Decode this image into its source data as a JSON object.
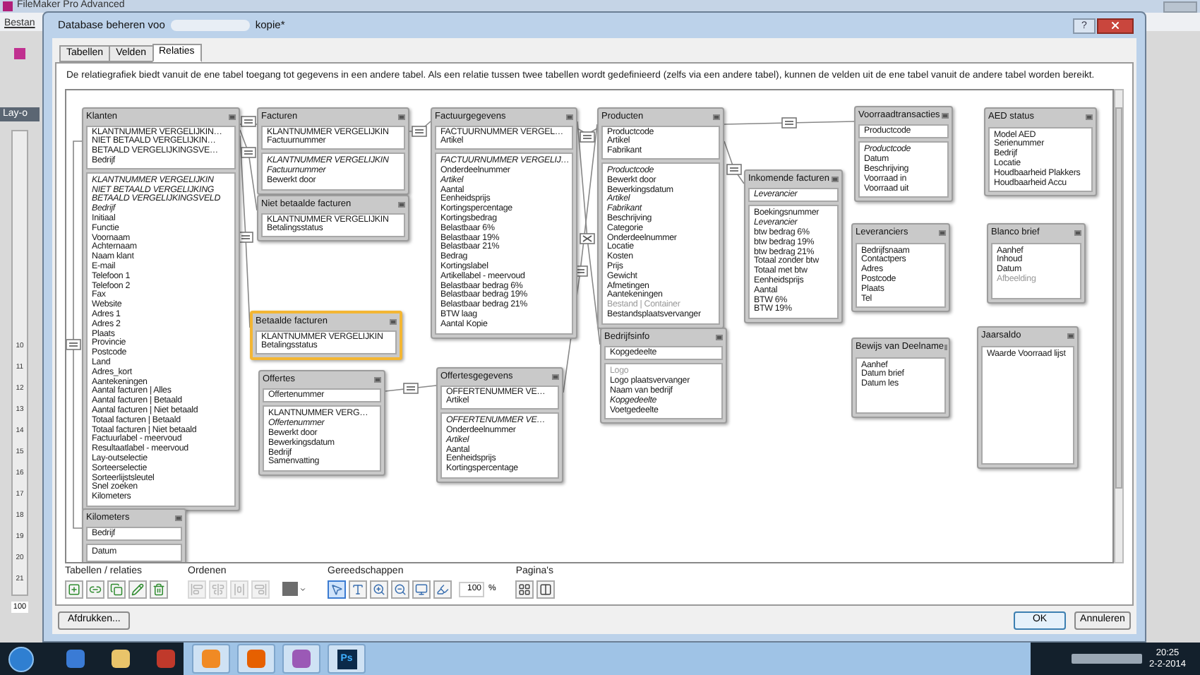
{
  "background_window": {
    "title": "FileMaker Pro Advanced",
    "menu_item": "Bestan",
    "panel_label": "Lay-o",
    "ruler_marks": [
      "10",
      "11",
      "12",
      "13",
      "14",
      "15",
      "16",
      "17",
      "18",
      "19",
      "20",
      "21"
    ],
    "zoom": "100"
  },
  "dialog": {
    "title_start": "Database beheren voo",
    "title_end": "kopie*",
    "help": "?"
  },
  "tabs": [
    {
      "label": "Tabellen",
      "selected": false
    },
    {
      "label": "Velden",
      "selected": false
    },
    {
      "label": "Relaties",
      "selected": true
    }
  ],
  "description": "De relatiegrafiek biedt vanuit de ene tabel toegang tot gegevens in een andere tabel. Als een relatie tussen twee tabellen wordt gedefinieerd (zelfs via een andere tabel), kunnen de velden uit de ene tabel vanuit de andere tabel worden bereikt.",
  "tables": [
    {
      "name": "Klanten",
      "selected": false,
      "keys": [
        {
          "t": "KLANTNUMMER VERGELIJKIN…",
          "kind": "plain"
        },
        {
          "t": "NIET BETAALD VERGELIJKIN…",
          "kind": "plain"
        },
        {
          "t": "BETAALD VERGELIJKINGSVE…",
          "kind": "plain"
        },
        {
          "t": "Bedrijf",
          "kind": "plain"
        }
      ],
      "fields": [
        {
          "t": "KLANTNUMMER VERGELIJKIN",
          "kind": "italic"
        },
        {
          "t": "NIET BETAALD VERGELIJKING",
          "kind": "italic"
        },
        {
          "t": "BETAALD VERGELIJKINGSVELD",
          "kind": "italic"
        },
        {
          "t": "Bedrijf",
          "kind": "italic"
        },
        {
          "t": "Initiaal",
          "kind": "plain"
        },
        {
          "t": "Functie",
          "kind": "plain"
        },
        {
          "t": "Voornaam",
          "kind": "plain"
        },
        {
          "t": "Achternaam",
          "kind": "plain"
        },
        {
          "t": "Naam klant",
          "kind": "plain"
        },
        {
          "t": "E-mail",
          "kind": "plain"
        },
        {
          "t": "Telefoon 1",
          "kind": "plain"
        },
        {
          "t": "Telefoon 2",
          "kind": "plain"
        },
        {
          "t": "Fax",
          "kind": "plain"
        },
        {
          "t": "Website",
          "kind": "plain"
        },
        {
          "t": "Adres 1",
          "kind": "plain"
        },
        {
          "t": "Adres 2",
          "kind": "plain"
        },
        {
          "t": "Plaats",
          "kind": "plain"
        },
        {
          "t": "Provincie",
          "kind": "plain"
        },
        {
          "t": "Postcode",
          "kind": "plain"
        },
        {
          "t": "Land",
          "kind": "plain"
        },
        {
          "t": "Adres_kort",
          "kind": "plain"
        },
        {
          "t": "Aantekeningen",
          "kind": "plain"
        },
        {
          "t": "Aantal facturen | Alles",
          "kind": "plain"
        },
        {
          "t": "Aantal facturen | Betaald",
          "kind": "plain"
        },
        {
          "t": "Aantal facturen | Niet betaald",
          "kind": "plain"
        },
        {
          "t": "Totaal facturen | Betaald",
          "kind": "plain"
        },
        {
          "t": "Totaal facturen | Niet betaald",
          "kind": "plain"
        },
        {
          "t": "Factuurlabel - meervoud",
          "kind": "plain"
        },
        {
          "t": "Resultaatlabel - meervoud",
          "kind": "plain"
        },
        {
          "t": "Lay-outselectie",
          "kind": "plain"
        },
        {
          "t": "Sorteerselectie",
          "kind": "plain"
        },
        {
          "t": "Sorteerlijstsleutel",
          "kind": "plain"
        },
        {
          "t": "Snel zoeken",
          "kind": "plain"
        },
        {
          "t": "Kilometers",
          "kind": "plain"
        }
      ]
    },
    {
      "name": "Facturen",
      "selected": false,
      "keys": [
        {
          "t": "KLANTNUMMER VERGELIJKIN",
          "kind": "plain"
        },
        {
          "t": "Factuurnummer",
          "kind": "plain"
        }
      ],
      "fields": [
        {
          "t": "KLANTNUMMER VERGELIJKIN",
          "kind": "italic"
        },
        {
          "t": "Factuurnummer",
          "kind": "italic"
        },
        {
          "t": "Bewerkt door",
          "kind": "plain"
        }
      ]
    },
    {
      "name": "Niet betaalde facturen",
      "selected": false,
      "keys": [
        {
          "t": "KLANTNUMMER VERGELIJKIN",
          "kind": "plain"
        },
        {
          "t": "Betalingsstatus",
          "kind": "plain"
        }
      ]
    },
    {
      "name": "Betaalde facturen",
      "selected": true,
      "keys": [
        {
          "t": "KLANTNUMMER VERGELIJKIN",
          "kind": "plain"
        },
        {
          "t": "Betalingsstatus",
          "kind": "plain"
        }
      ]
    },
    {
      "name": "Offertes",
      "selected": false,
      "keys": [
        {
          "t": "Offertenummer",
          "kind": "plain"
        }
      ],
      "fields": [
        {
          "t": "KLANTNUMMER VERG…",
          "kind": "plain"
        },
        {
          "t": "Offertenummer",
          "kind": "italic"
        },
        {
          "t": "Bewerkt door",
          "kind": "plain"
        },
        {
          "t": "Bewerkingsdatum",
          "kind": "plain"
        },
        {
          "t": "Bedrijf",
          "kind": "plain"
        },
        {
          "t": "Samenvatting",
          "kind": "plain"
        }
      ]
    },
    {
      "name": "Kilometers",
      "selected": false,
      "keys": [
        {
          "t": "Bedrijf",
          "kind": "plain"
        }
      ],
      "fields": [
        {
          "t": "Datum",
          "kind": "plain"
        }
      ]
    },
    {
      "name": "Factuurgegevens",
      "selected": false,
      "keys": [
        {
          "t": "FACTUURNUMMER VERGEL…",
          "kind": "plain"
        },
        {
          "t": "Artikel",
          "kind": "plain"
        }
      ],
      "fields": [
        {
          "t": "FACTUURNUMMER VERGELIJ…",
          "kind": "italic"
        },
        {
          "t": "Onderdeelnummer",
          "kind": "plain"
        },
        {
          "t": "Artikel",
          "kind": "italic"
        },
        {
          "t": "Aantal",
          "kind": "plain"
        },
        {
          "t": "Eenheidsprijs",
          "kind": "plain"
        },
        {
          "t": "Kortingspercentage",
          "kind": "plain"
        },
        {
          "t": "Kortingsbedrag",
          "kind": "plain"
        },
        {
          "t": "Belastbaar 6%",
          "kind": "plain"
        },
        {
          "t": "Belastbaar 19%",
          "kind": "plain"
        },
        {
          "t": "Belastbaar 21%",
          "kind": "plain"
        },
        {
          "t": "Bedrag",
          "kind": "plain"
        },
        {
          "t": "Kortingslabel",
          "kind": "plain"
        },
        {
          "t": "Artikellabel - meervoud",
          "kind": "plain"
        },
        {
          "t": "Belastbaar bedrag 6%",
          "kind": "plain"
        },
        {
          "t": "Belastbaar bedrag 19%",
          "kind": "plain"
        },
        {
          "t": "Belastbaar bedrag 21%",
          "kind": "plain"
        },
        {
          "t": "BTW laag",
          "kind": "plain"
        },
        {
          "t": "Aantal Kopie",
          "kind": "plain"
        }
      ]
    },
    {
      "name": "Offertesgegevens",
      "selected": false,
      "keys": [
        {
          "t": "OFFERTENUMMER VE…",
          "kind": "plain"
        },
        {
          "t": "Artikel",
          "kind": "plain"
        }
      ],
      "fields": [
        {
          "t": "OFFERTENUMMER VE…",
          "kind": "italic"
        },
        {
          "t": "Onderdeelnummer",
          "kind": "plain"
        },
        {
          "t": "Artikel",
          "kind": "italic"
        },
        {
          "t": "Aantal",
          "kind": "plain"
        },
        {
          "t": "Eenheidsprijs",
          "kind": "plain"
        },
        {
          "t": "Kortingspercentage",
          "kind": "plain"
        }
      ]
    },
    {
      "name": "Producten",
      "selected": false,
      "keys": [
        {
          "t": "Productcode",
          "kind": "plain"
        },
        {
          "t": "Artikel",
          "kind": "plain"
        },
        {
          "t": "Fabrikant",
          "kind": "plain"
        }
      ],
      "fields": [
        {
          "t": "Productcode",
          "kind": "italic"
        },
        {
          "t": "Bewerkt door",
          "kind": "plain"
        },
        {
          "t": "Bewerkingsdatum",
          "kind": "plain"
        },
        {
          "t": "Artikel",
          "kind": "italic"
        },
        {
          "t": "Fabrikant",
          "kind": "italic"
        },
        {
          "t": "Beschrijving",
          "kind": "plain"
        },
        {
          "t": "Categorie",
          "kind": "plain"
        },
        {
          "t": "Onderdeelnummer",
          "kind": "plain"
        },
        {
          "t": "Locatie",
          "kind": "plain"
        },
        {
          "t": "Kosten",
          "kind": "plain"
        },
        {
          "t": "Prijs",
          "kind": "plain"
        },
        {
          "t": "Gewicht",
          "kind": "plain"
        },
        {
          "t": "Afmetingen",
          "kind": "plain"
        },
        {
          "t": "Aantekeningen",
          "kind": "plain"
        },
        {
          "t": "Bestand | Container",
          "kind": "dim"
        },
        {
          "t": "Bestandsplaatsvervanger",
          "kind": "plain"
        }
      ]
    },
    {
      "name": "Bedrijfsinfo",
      "selected": false,
      "keys": [
        {
          "t": "Kopgedeelte",
          "kind": "plain"
        }
      ],
      "fields": [
        {
          "t": "Logo",
          "kind": "dim"
        },
        {
          "t": "Logo plaatsvervanger",
          "kind": "plain"
        },
        {
          "t": "Naam van bedrijf",
          "kind": "plain"
        },
        {
          "t": "Kopgedeelte",
          "kind": "italic"
        },
        {
          "t": "Voetgedeelte",
          "kind": "plain"
        }
      ]
    },
    {
      "name": "Inkomende facturen",
      "selected": false,
      "keys": [
        {
          "t": "Leverancier",
          "kind": "italic"
        }
      ],
      "fields": [
        {
          "t": "Boekingsnummer",
          "kind": "plain"
        },
        {
          "t": "Leverancier",
          "kind": "italic"
        },
        {
          "t": "btw bedrag 6%",
          "kind": "plain"
        },
        {
          "t": "btw bedrag 19%",
          "kind": "plain"
        },
        {
          "t": "btw bedrag 21%",
          "kind": "plain"
        },
        {
          "t": "Totaal zonder btw",
          "kind": "plain"
        },
        {
          "t": "Totaal met btw",
          "kind": "plain"
        },
        {
          "t": "Eenheidsprijs",
          "kind": "plain"
        },
        {
          "t": "Aantal",
          "kind": "plain"
        },
        {
          "t": "BTW 6%",
          "kind": "plain"
        },
        {
          "t": "BTW 19%",
          "kind": "plain"
        }
      ]
    },
    {
      "name": "Voorraadtransacties",
      "selected": false,
      "keys": [
        {
          "t": "Productcode",
          "kind": "plain"
        }
      ],
      "fields": [
        {
          "t": "Productcode",
          "kind": "italic"
        },
        {
          "t": "Datum",
          "kind": "plain"
        },
        {
          "t": "Beschrijving",
          "kind": "plain"
        },
        {
          "t": "Voorraad in",
          "kind": "plain"
        },
        {
          "t": "Voorraad uit",
          "kind": "plain"
        }
      ]
    },
    {
      "name": "AED status",
      "selected": false,
      "fields": [
        {
          "t": "Model AED",
          "kind": "plain"
        },
        {
          "t": "Serienummer",
          "kind": "plain"
        },
        {
          "t": "Bedrijf",
          "kind": "plain"
        },
        {
          "t": "Locatie",
          "kind": "plain"
        },
        {
          "t": "Houdbaarheid Plakkers",
          "kind": "plain"
        },
        {
          "t": "Houdbaarheid Accu",
          "kind": "plain"
        }
      ]
    },
    {
      "name": "Leveranciers",
      "selected": false,
      "fields": [
        {
          "t": "Bedrijfsnaam",
          "kind": "plain"
        },
        {
          "t": "Contactpers",
          "kind": "plain"
        },
        {
          "t": "Adres",
          "kind": "plain"
        },
        {
          "t": "Postcode",
          "kind": "plain"
        },
        {
          "t": "Plaats",
          "kind": "plain"
        },
        {
          "t": "Tel",
          "kind": "plain"
        }
      ]
    },
    {
      "name": "Blanco brief",
      "selected": false,
      "fields": [
        {
          "t": "Aanhef",
          "kind": "plain"
        },
        {
          "t": "Inhoud",
          "kind": "plain"
        },
        {
          "t": "Datum",
          "kind": "plain"
        },
        {
          "t": "Afbeelding",
          "kind": "dim"
        }
      ]
    },
    {
      "name": "Bewijs van Deelname",
      "selected": false,
      "fields": [
        {
          "t": "Aanhef",
          "kind": "plain"
        },
        {
          "t": "Datum brief",
          "kind": "plain"
        },
        {
          "t": "Datum les",
          "kind": "plain"
        }
      ]
    },
    {
      "name": "Jaarsaldo",
      "selected": false,
      "fields": [
        {
          "t": "Waarde Voorraad lijst",
          "kind": "plain"
        }
      ]
    }
  ],
  "toolbar": [
    {
      "label": "Tabellen / relaties",
      "items": [
        {
          "kind": "icon",
          "disabled": false
        },
        {
          "kind": "icon",
          "disabled": false
        },
        {
          "kind": "icon",
          "disabled": false
        },
        {
          "kind": "icon",
          "disabled": false
        },
        {
          "kind": "icon",
          "disabled": false
        }
      ]
    },
    {
      "label": "Ordenen",
      "items": [
        {
          "kind": "icon",
          "disabled": true
        },
        {
          "kind": "icon",
          "disabled": true
        },
        {
          "kind": "icon",
          "disabled": true
        },
        {
          "kind": "icon",
          "disabled": true
        },
        {
          "kind": "swatch",
          "color": "#6d6d6d"
        }
      ]
    },
    {
      "label": "Gereedschappen",
      "items": [
        {
          "kind": "icon",
          "selected": true
        },
        {
          "kind": "icon",
          "selected": false
        },
        {
          "kind": "icon",
          "selected": false
        },
        {
          "kind": "icon",
          "selected": false
        },
        {
          "kind": "icon",
          "selected": false
        },
        {
          "kind": "icon",
          "selected": false
        },
        {
          "kind": "zoom",
          "value": "100",
          "unit": "%"
        }
      ]
    },
    {
      "label": "Pagina's",
      "items": [
        {
          "kind": "icon",
          "disabled": false
        },
        {
          "kind": "icon",
          "disabled": false
        }
      ]
    }
  ],
  "buttons": {
    "print": "Afdrukken...",
    "ok": "OK",
    "cancel": "Annuleren"
  },
  "taskbar": {
    "apps": [
      {
        "running": false
      },
      {
        "running": false
      },
      {
        "running": false
      },
      {
        "running": true
      },
      {
        "running": true
      },
      {
        "running": true
      },
      {
        "running": true,
        "label": "Ps"
      }
    ],
    "time": "20:25",
    "date": "2-2-2014"
  }
}
